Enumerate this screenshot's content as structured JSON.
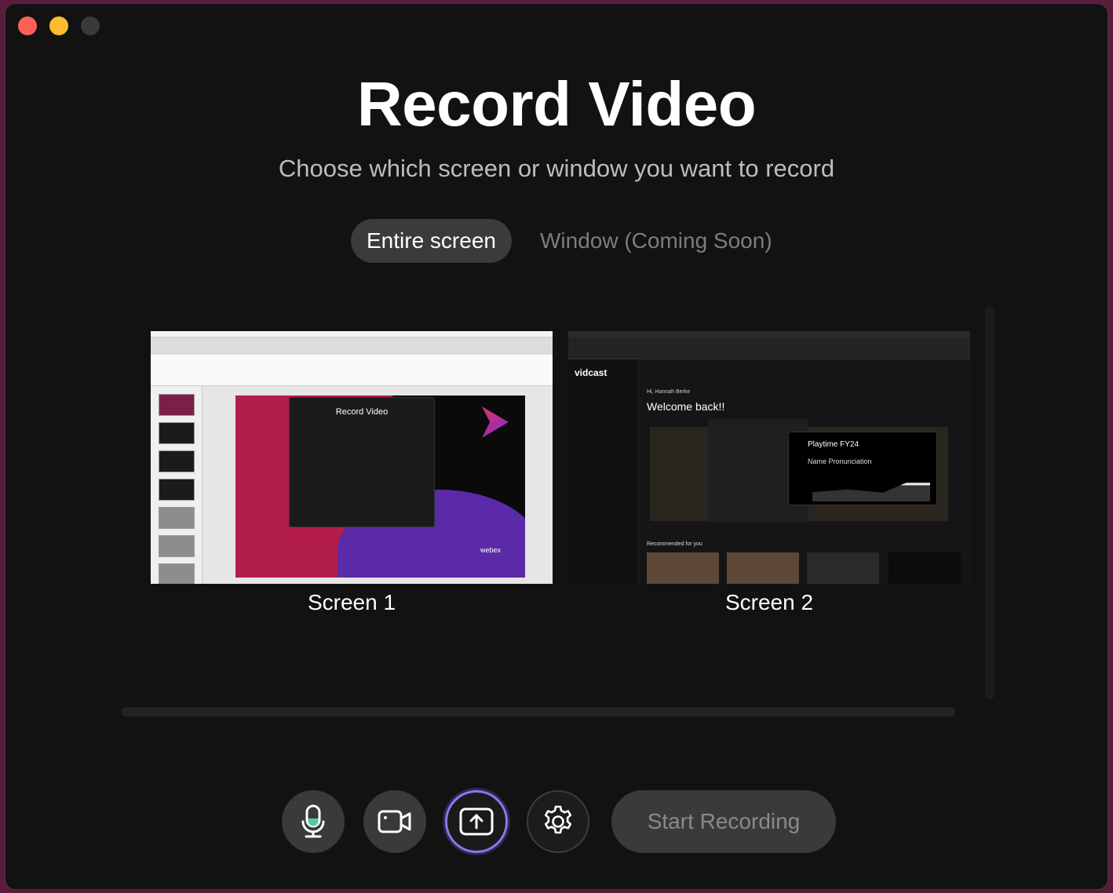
{
  "header": {
    "title": "Record Video",
    "subtitle": "Choose which screen or window you want to record"
  },
  "tabs": [
    {
      "label": "Entire screen",
      "active": true
    },
    {
      "label": "Window (Coming Soon)",
      "active": false
    }
  ],
  "screens": [
    {
      "label": "Screen 1",
      "preview": {
        "dialog_title": "Record Video",
        "brand": "webex"
      }
    },
    {
      "label": "Screen 2",
      "preview": {
        "brand": "vidcast",
        "greeting": "Hi, Hannah Berke",
        "welcome": "Welcome back!!",
        "popup_title": "Playtime FY24",
        "popup_sub": "Name Pronunciation",
        "recommended": "Recommended for you"
      }
    }
  ],
  "controls": {
    "mic": "microphone-icon",
    "camera": "camera-icon",
    "share": "share-screen-icon",
    "settings": "gear-icon",
    "start_label": "Start Recording"
  },
  "colors": {
    "background": "#121212",
    "accent": "#8b79e8",
    "mic_level": "#55c8a0"
  }
}
